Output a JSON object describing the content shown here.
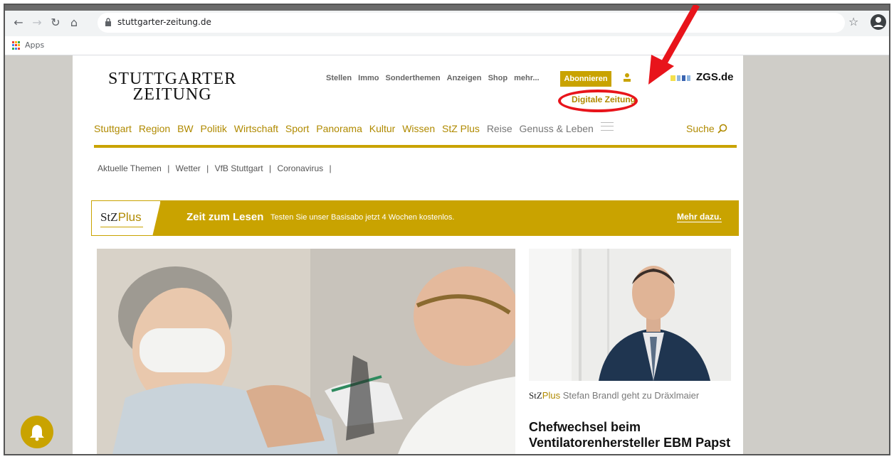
{
  "browser": {
    "url": "stuttgarter-zeitung.de",
    "bookmarks_apps_label": "Apps"
  },
  "header": {
    "logo_line1": "STUTTGARTER",
    "logo_line2": "ZEITUNG",
    "top_links": [
      "Stellen",
      "Immo",
      "Sonderthemen",
      "Anzeigen",
      "Shop",
      "mehr..."
    ],
    "abonnieren_label": "Abonnieren",
    "digitale_zeitung_label": "Digitale Zeitung",
    "zgs_label": "ZGS.de"
  },
  "main_nav": {
    "items": [
      "Stuttgart",
      "Region",
      "BW",
      "Politik",
      "Wirtschaft",
      "Sport",
      "Panorama",
      "Kultur",
      "Wissen",
      "StZ Plus",
      "Reise",
      "Genuss & Leben"
    ],
    "search_label": "Suche"
  },
  "topics": {
    "items": [
      "Aktuelle Themen",
      "Wetter",
      "VfB Stuttgart",
      "Coronavirus"
    ]
  },
  "promo": {
    "logo_stz": "StZ",
    "logo_plus": "Plus",
    "title": "Zeit zum Lesen",
    "subtitle": "Testen Sie unser Basisabo jetzt 4 Wochen kostenlos.",
    "cta": "Mehr dazu."
  },
  "side_article": {
    "kicker_stz": "StZ",
    "kicker_plus": "Plus",
    "kicker": "Stefan Brandl geht zu Dräxlmaier",
    "headline": "Chefwechsel beim Ventilatorenhersteller EBM Papst"
  },
  "colors": {
    "accent": "#c9a300",
    "annotation": "#e8141b"
  }
}
